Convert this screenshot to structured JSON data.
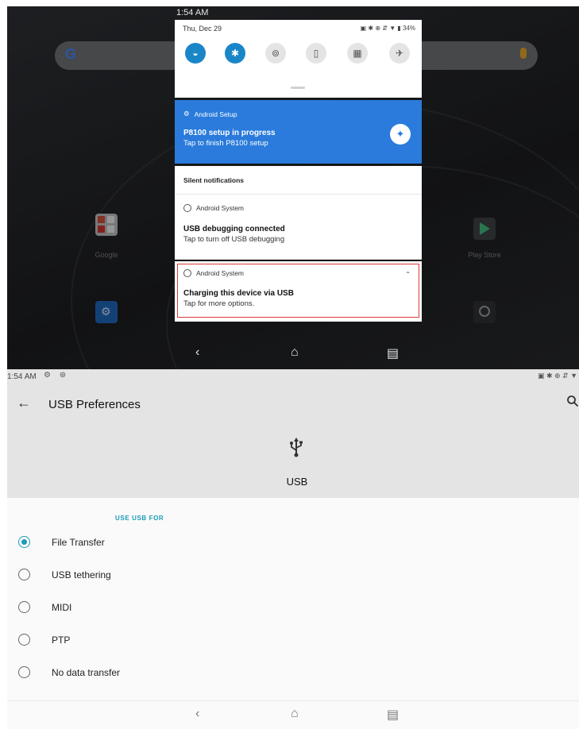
{
  "shade": {
    "time": "1:54 AM",
    "date": "Thu, Dec 29",
    "status_icons": "▣ ✱ ⊕ ⇵ ▼ ▮",
    "battery": "34%",
    "tiles": [
      {
        "name": "wifi-tile",
        "icon": "wifi-icon",
        "glyph": "◒",
        "on": true
      },
      {
        "name": "bluetooth-tile",
        "icon": "bluetooth-icon",
        "glyph": "✱",
        "on": true
      },
      {
        "name": "location-tile",
        "icon": "location-icon",
        "glyph": "⊚",
        "on": false
      },
      {
        "name": "rotate-tile",
        "icon": "auto-rotate-icon",
        "glyph": "▯",
        "on": false
      },
      {
        "name": "keyboard-tile",
        "icon": "keyboard-icon",
        "glyph": "▦",
        "on": false
      },
      {
        "name": "airplane-tile",
        "icon": "airplane-icon",
        "glyph": "✈",
        "on": false
      }
    ],
    "setup": {
      "app": "Android Setup",
      "title": "P8100 setup in progress",
      "text": "Tap to finish P8100 setup"
    },
    "silent_header": "Silent notifications",
    "usb_debug": {
      "app": "Android System",
      "title": "USB debugging connected",
      "text": "Tap to turn off USB debugging"
    },
    "charging": {
      "app": "Android System",
      "title": "Charging this device via USB",
      "text": "Tap for more options."
    }
  },
  "launcher": {
    "apps": [
      {
        "name": "google-folder",
        "label": "Google"
      },
      {
        "name": "play-store-app",
        "label": "Play Store"
      }
    ],
    "accent_colors": {
      "google_blue": "#4285f4",
      "mic": "#e0a12a"
    }
  },
  "usb_prefs": {
    "time": "1:54 AM",
    "left_status_icons": "⚙ ⊛",
    "right_status_icons": "▣ ✱ ⊕ ⇵ ▼",
    "title": "USB Preferences",
    "hero_label": "USB",
    "section": "USE USB FOR",
    "options": [
      {
        "label": "File Transfer",
        "selected": true
      },
      {
        "label": "USB tethering",
        "selected": false
      },
      {
        "label": "MIDI",
        "selected": false
      },
      {
        "label": "PTP",
        "selected": false
      },
      {
        "label": "No data transfer",
        "selected": false
      }
    ],
    "accent": "#1a9bb8"
  },
  "nav": {
    "back": "‹",
    "home": "⌂",
    "recents": "▤"
  }
}
